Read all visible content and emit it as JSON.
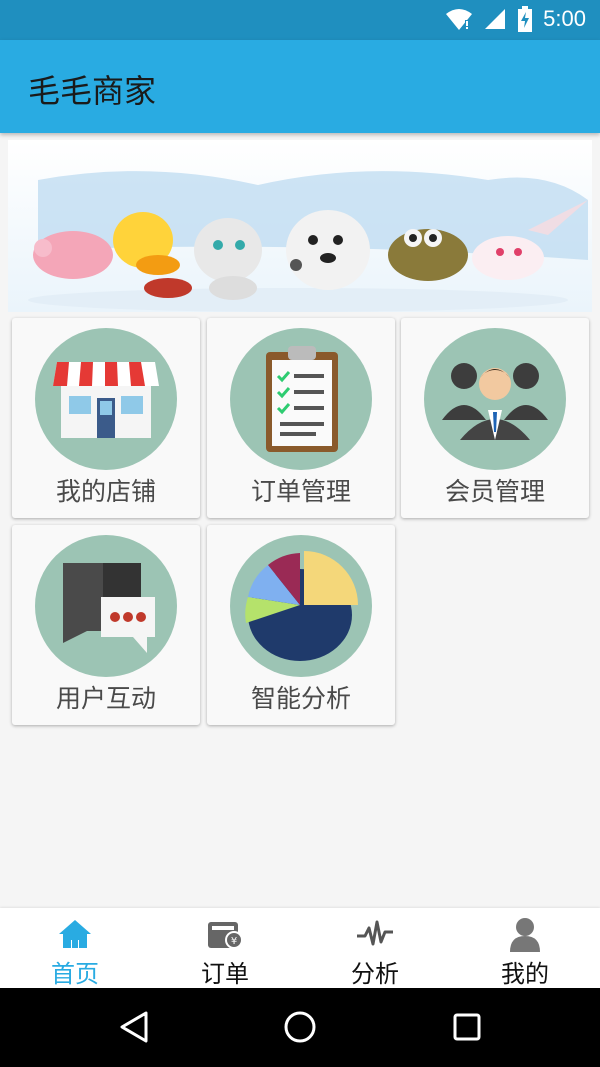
{
  "status_bar": {
    "time": "5:00",
    "icons": [
      "wifi-icon",
      "signal-icon",
      "battery-charging-icon"
    ]
  },
  "app_bar": {
    "title": "毛毛商家"
  },
  "grid": {
    "tiles": [
      {
        "label": "我的店铺",
        "icon": "store-icon"
      },
      {
        "label": "订单管理",
        "icon": "clipboard-icon"
      },
      {
        "label": "会员管理",
        "icon": "members-icon"
      },
      {
        "label": "用户互动",
        "icon": "chat-icon"
      },
      {
        "label": "智能分析",
        "icon": "pie-chart-icon"
      }
    ]
  },
  "bottom_nav": {
    "items": [
      {
        "label": "首页",
        "icon": "home-icon",
        "active": true
      },
      {
        "label": "订单",
        "icon": "order-wallet-icon",
        "active": false
      },
      {
        "label": "分析",
        "icon": "pulse-icon",
        "active": false
      },
      {
        "label": "我的",
        "icon": "person-icon",
        "active": false
      }
    ]
  },
  "colors": {
    "status_bar": "#1f8fbf",
    "app_bar": "#29abe2",
    "tile_circle": "#9cc4b4",
    "active_nav": "#29abe2"
  }
}
